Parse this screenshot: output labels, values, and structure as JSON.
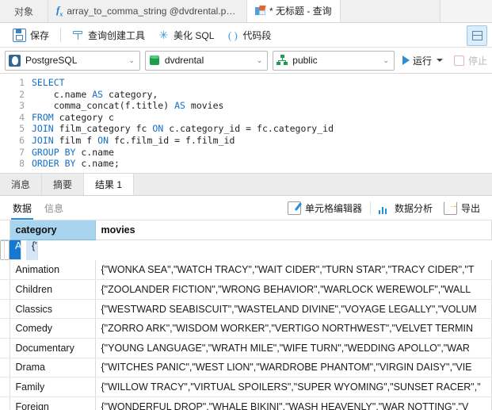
{
  "window": {
    "tabs": [
      {
        "label": "对象",
        "icon": "object-tab-icon",
        "active": false
      },
      {
        "label": "array_to_comma_string @dvdrental.pub...",
        "icon": "function-fx-icon",
        "active": false
      },
      {
        "label": "* 无标题 - 查询",
        "icon": "query-tab-icon",
        "active": true
      }
    ]
  },
  "toolbar": {
    "save_label": "保存",
    "query_builder_label": "查询创建工具",
    "beautify_label": "美化 SQL",
    "snippet_label": "代码段",
    "layout_button_title": "布局"
  },
  "selectors": {
    "connection": "PostgreSQL",
    "database": "dvdrental",
    "schema": "public",
    "run_label": "运行",
    "stop_label": "停止"
  },
  "editor": {
    "lines": [
      {
        "n": "1",
        "text": "SELECT"
      },
      {
        "n": "2",
        "text": "    c.name AS category,"
      },
      {
        "n": "3",
        "text": "    comma_concat(f.title) AS movies"
      },
      {
        "n": "4",
        "text": "FROM category c"
      },
      {
        "n": "5",
        "text": "JOIN film_category fc ON c.category_id = fc.category_id"
      },
      {
        "n": "6",
        "text": "JOIN film f ON fc.film_id = f.film_id"
      },
      {
        "n": "7",
        "text": "GROUP BY c.name"
      },
      {
        "n": "8",
        "text": "ORDER BY c.name;"
      }
    ]
  },
  "result_tabs": [
    {
      "label": "消息",
      "active": false
    },
    {
      "label": "摘要",
      "active": false
    },
    {
      "label": "结果 1",
      "active": true
    }
  ],
  "data_toolbar": {
    "sub_tabs": [
      {
        "label": "数据",
        "active": true
      },
      {
        "label": "信息",
        "active": false
      }
    ],
    "cell_editor_label": "单元格编辑器",
    "data_analysis_label": "数据分析",
    "export_label": "导出"
  },
  "grid": {
    "columns": [
      "category",
      "movies"
    ],
    "rows": [
      {
        "category": "Action",
        "movies": "{\"WORST BANGER\",\"WOMEN DORADO\",\"WEREWOLF LOLA\",\"WATERFRONT D",
        "selected": true
      },
      {
        "category": "Animation",
        "movies": "{\"WONKA SEA\",\"WATCH TRACY\",\"WAIT CIDER\",\"TURN STAR\",\"TRACY CIDER\",\"T",
        "selected": false
      },
      {
        "category": "Children",
        "movies": "{\"ZOOLANDER FICTION\",\"WRONG BEHAVIOR\",\"WARLOCK WEREWOLF\",\"WALL",
        "selected": false
      },
      {
        "category": "Classics",
        "movies": "{\"WESTWARD SEABISCUIT\",\"WASTELAND DIVINE\",\"VOYAGE LEGALLY\",\"VOLUM",
        "selected": false
      },
      {
        "category": "Comedy",
        "movies": "{\"ZORRO ARK\",\"WISDOM WORKER\",\"VERTIGO NORTHWEST\",\"VELVET TERMIN",
        "selected": false
      },
      {
        "category": "Documentary",
        "movies": "{\"YOUNG LANGUAGE\",\"WRATH MILE\",\"WIFE TURN\",\"WEDDING APOLLO\",\"WAR",
        "selected": false
      },
      {
        "category": "Drama",
        "movies": "{\"WITCHES PANIC\",\"WEST LION\",\"WARDROBE PHANTOM\",\"VIRGIN DAISY\",\"VIE",
        "selected": false
      },
      {
        "category": "Family",
        "movies": "{\"WILLOW TRACY\",\"VIRTUAL SPOILERS\",\"SUPER WYOMING\",\"SUNSET RACER\",\"",
        "selected": false
      },
      {
        "category": "Foreign",
        "movies": "{\"WONDERFUL DROP\",\"WHALE BIKINI\",\"WASH HEAVENLY\",\"WAR NOTTING\",\"V",
        "selected": false
      }
    ]
  },
  "colors": {
    "accent": "#1e90e0",
    "selection": "#1678d0",
    "header": "#a8d4f0",
    "postgres": "#336791",
    "green": "#1e9e4a"
  }
}
